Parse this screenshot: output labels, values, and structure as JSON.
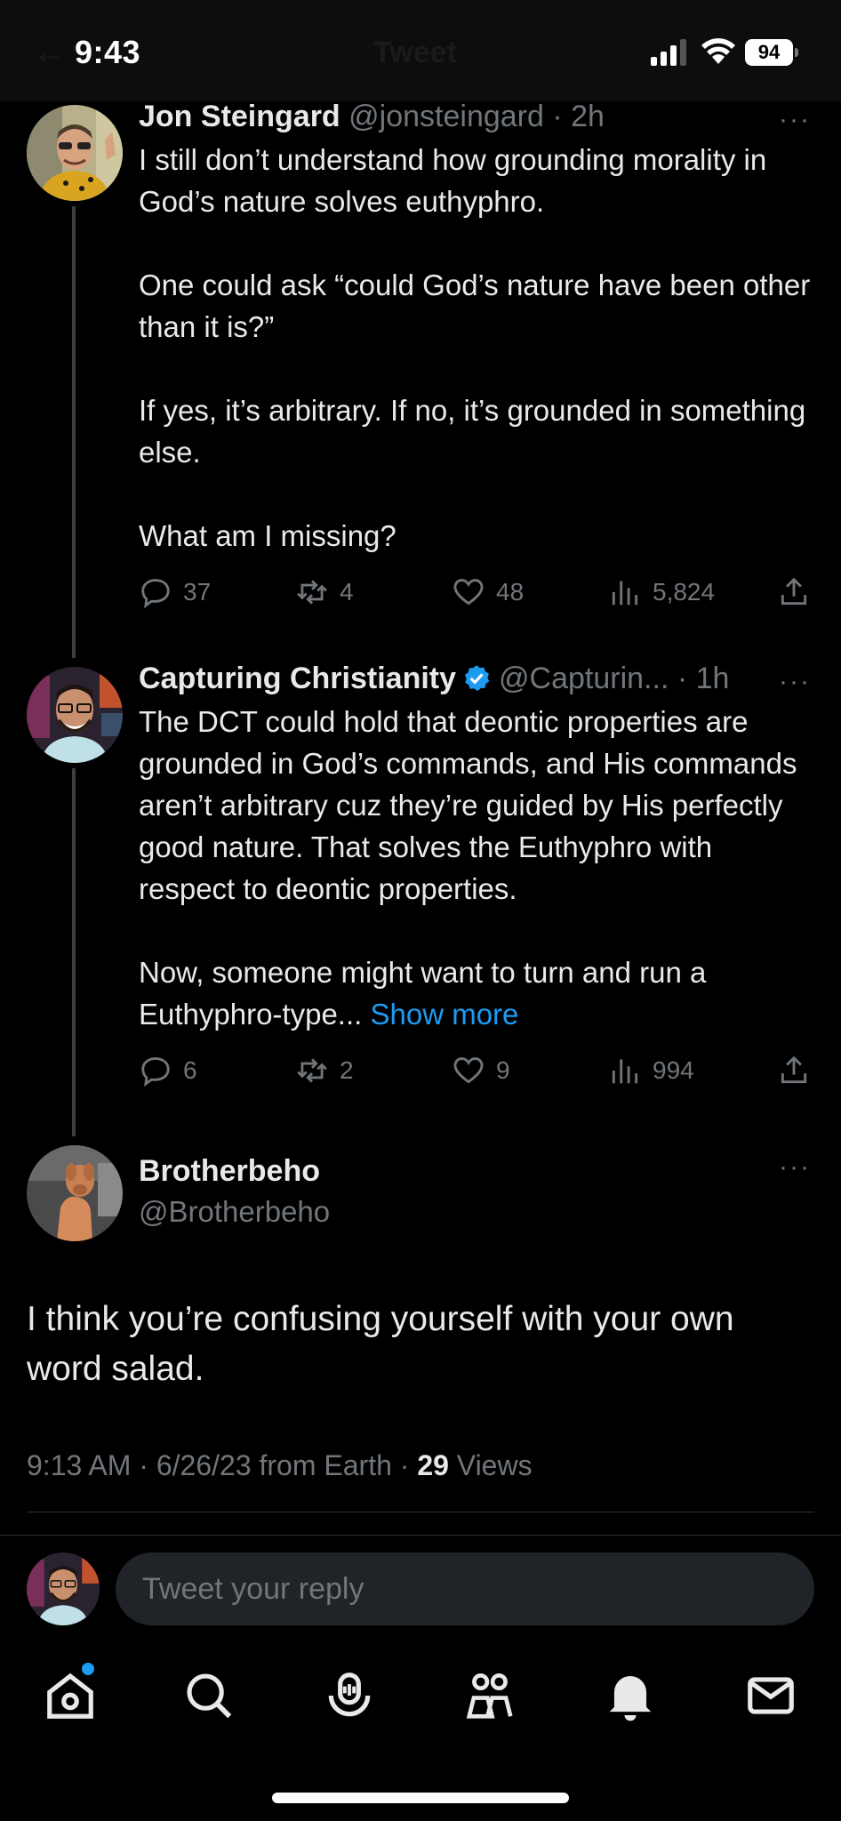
{
  "status_bar": {
    "time": "9:43",
    "battery": "94"
  },
  "header": {
    "title": "Tweet"
  },
  "thread": [
    {
      "name": "Jon Steingard",
      "handle": "@jonsteingard",
      "time": "· 2h",
      "paragraphs": [
        "I still don’t understand how grounding morality in God’s nature solves euthyphro.",
        "One could ask “could God’s nature have been other than it is?”",
        "If yes, it’s arbitrary. If no, it’s grounded in something else.",
        "What am I missing?"
      ],
      "replies": "37",
      "retweets": "4",
      "likes": "48",
      "views": "5,824"
    },
    {
      "name": "Capturing Christianity",
      "handle": "@Capturin...",
      "time": "· 1h",
      "paragraphs": [
        "The DCT could hold that deontic properties are grounded in God’s commands, and His commands aren’t arbitrary cuz they’re guided by His perfectly good nature. That solves the Euthyphro with respect to deontic properties.",
        "Now, someone might want to turn and run a Euthyphro-type..."
      ],
      "show_more": "Show more",
      "replies": "6",
      "retweets": "2",
      "likes": "9",
      "views": "994"
    }
  ],
  "main_tweet": {
    "name": "Brotherbeho",
    "handle": "@Brotherbeho",
    "text": "I think you’re confusing yourself with your own word salad.",
    "meta": "9:13 AM · 6/26/23 from Earth · ",
    "views_count": "29",
    "views_label": " Views"
  },
  "reply": {
    "placeholder": "Tweet your reply"
  },
  "colors": {
    "accent": "#1d9bf0",
    "background": "#000000",
    "secondary_text": "#71767b"
  }
}
